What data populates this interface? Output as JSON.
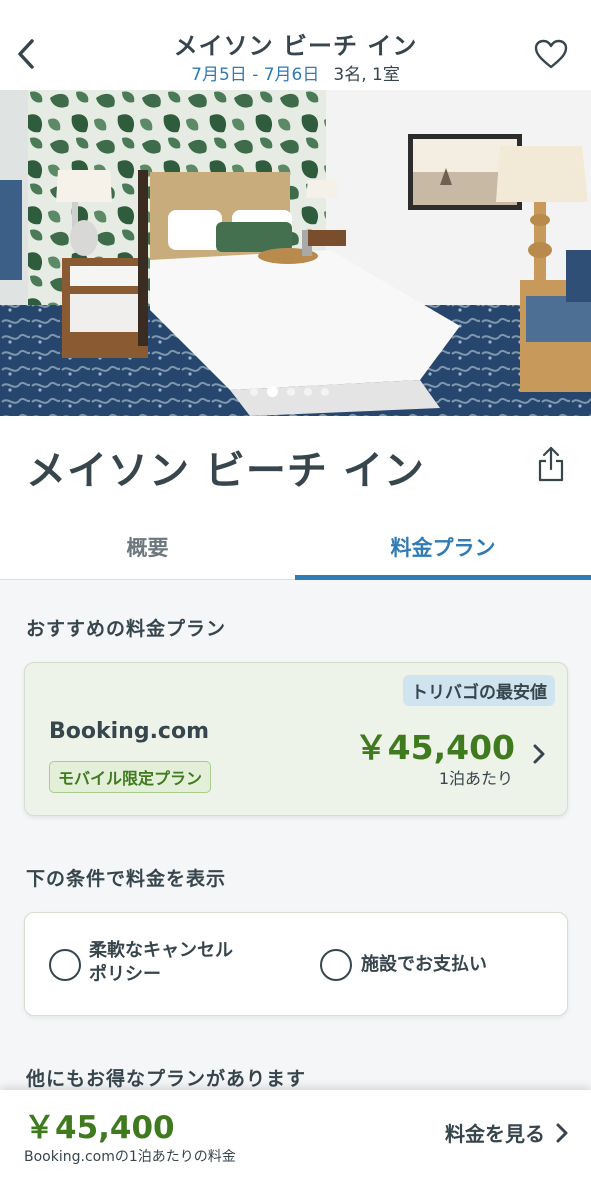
{
  "header": {
    "title": "メイソン ビーチ イン",
    "dates": "7月5日 - 7月6日",
    "guests": "3名, 1室",
    "back_icon": "chevron-left-icon",
    "favorite_icon": "heart-outline-icon"
  },
  "gallery": {
    "image": "hotel-room-photo",
    "slide_count": 5,
    "active_slide": 2
  },
  "hotel": {
    "name": "メイソン ビーチ イン",
    "share_icon": "share-icon"
  },
  "tabs": {
    "overview": "概要",
    "rates": "料金プラン",
    "active": "rates"
  },
  "recommended": {
    "heading": "おすすめの料金プラン",
    "badge": "トリバゴの最安値",
    "provider": "Booking.com",
    "mobile_badge": "モバイル限定プラン",
    "price": "￥45,400",
    "per_night": "1泊あたり"
  },
  "conditions": {
    "heading": "下の条件で料金を表示",
    "option1_line1": "柔軟なキャンセル",
    "option1_line2": "ポリシー",
    "option2": "施設でお支払い"
  },
  "more_plans": {
    "heading": "他にもお得なプランがあります"
  },
  "bottom_bar": {
    "price": "￥45,400",
    "note": "Booking.comの1泊あたりの料金",
    "cta": "料金を見る"
  },
  "colors": {
    "primary_blue": "#2f7bb5",
    "price_green": "#3f7a1e",
    "text_dark": "#37454d",
    "deal_bg": "#eef3e9"
  }
}
